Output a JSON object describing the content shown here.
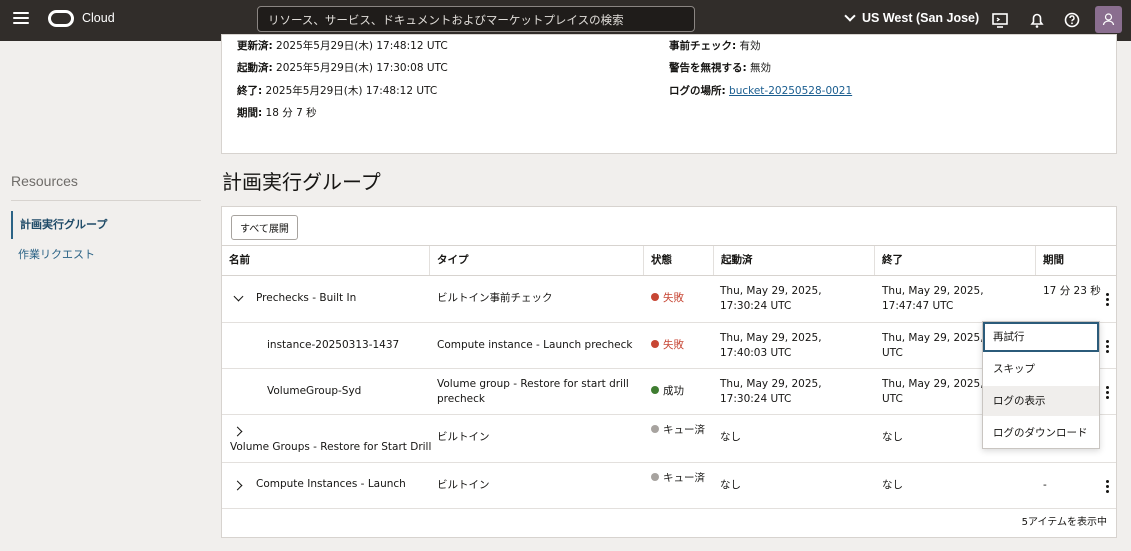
{
  "topbar": {
    "brand": "Cloud",
    "search_placeholder": "リソース、サービス、ドキュメントおよびマーケットプレイスの検索",
    "region": "US West (San Jose)"
  },
  "details": {
    "updated_label": "更新済:",
    "updated_value": "2025年5月29日(木) 17:48:12 UTC",
    "started_label": "起動済:",
    "started_value": "2025年5月29日(木) 17:30:08 UTC",
    "ended_label": "終了:",
    "ended_value": "2025年5月29日(木) 17:48:12 UTC",
    "duration_label": "期間:",
    "duration_value": "18 分 7 秒",
    "precheck_label": "事前チェック:",
    "precheck_value": "有効",
    "ignore_warn_label": "警告を無視する:",
    "ignore_warn_value": "無効",
    "log_location_label": "ログの場所:",
    "log_location_value": "bucket-20250528-0021"
  },
  "sidebar": {
    "title": "Resources",
    "items": [
      {
        "label": "計画実行グループ"
      },
      {
        "label": "作業リクエスト"
      }
    ]
  },
  "section": {
    "title": "計画実行グループ",
    "expand_all": "すべて展開",
    "footer": "5アイテムを表示中"
  },
  "table": {
    "headers": [
      "名前",
      "タイプ",
      "状態",
      "起動済",
      "終了",
      "期間"
    ],
    "rows": [
      {
        "name": "Prechecks - Built In",
        "type": "ビルトイン事前チェック",
        "status": "失敗",
        "started": "Thu, May 29, 2025, 17:30:24 UTC",
        "ended": "Thu, May 29, 2025, 17:47:47 UTC",
        "duration": "17 分 23 秒"
      },
      {
        "name": "instance-20250313-1437",
        "type": "Compute instance - Launch precheck",
        "status": "失敗",
        "started": "Thu, May 29, 2025, 17:40:03 UTC",
        "ended": "Thu, May 29, 2025, 1",
        "duration": ""
      },
      {
        "name": "VolumeGroup-Syd",
        "type": "Volume group - Restore for start drill precheck",
        "status": "成功",
        "started": "Thu, May 29, 2025, 17:30:24 UTC",
        "ended": "Thu, May 29, 2025, 17",
        "duration": ""
      },
      {
        "name": "Volume Groups - Restore for Start Drill",
        "type": "ビルトイン",
        "status": "キュー済",
        "started": "なし",
        "ended": "なし",
        "duration": ""
      },
      {
        "name": "Compute Instances - Launch",
        "type": "ビルトイン",
        "status": "キュー済",
        "started": "なし",
        "ended": "なし",
        "duration": "-"
      }
    ]
  },
  "menu": {
    "items": [
      "再試行",
      "スキップ",
      "ログの表示",
      "ログのダウンロード"
    ]
  },
  "colors": {
    "topbar": "#312d2a",
    "fail": "#c74634",
    "success": "#3f7d31",
    "queued": "#a7a39f",
    "link": "#1a5d8f"
  }
}
